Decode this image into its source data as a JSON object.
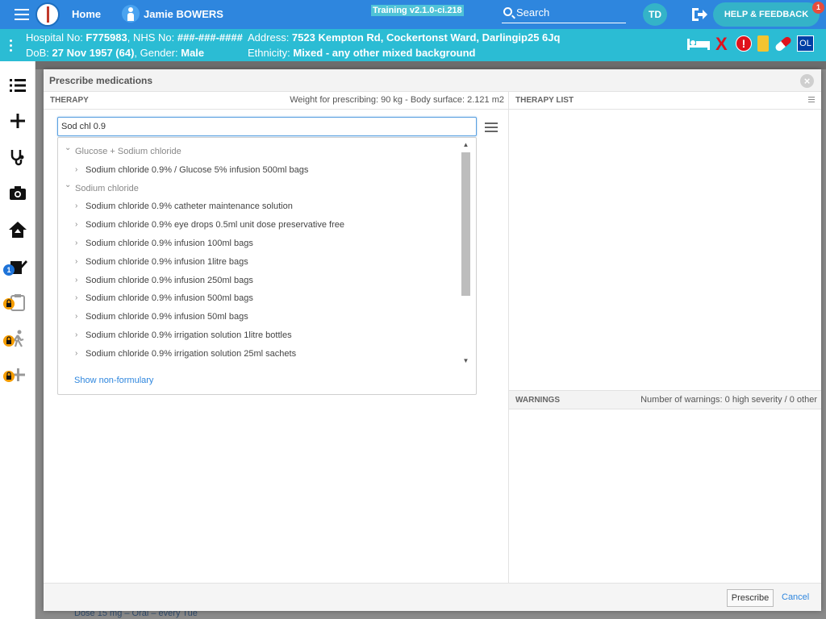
{
  "topbar": {
    "home_label": "Home",
    "patient_name": "Jamie BOWERS",
    "version": "Training v2.1.0-ci.218",
    "search_label": "Search",
    "user_initials": "TD",
    "help_label": "HELP & FEEDBACK",
    "help_badge": "1"
  },
  "banner": {
    "hospital_label": "Hospital No: ",
    "hospital_no": "F775983",
    "nhs_label": ", NHS No: ",
    "nhs_no": "###-###-####",
    "address_label": "Address: ",
    "address": "7523 Kempton Rd, Cockertonst Ward, Darlingip25 6Jq",
    "dob_label": "DoB: ",
    "dob": "27 Nov 1957 (64)",
    "gender_label": ", Gender: ",
    "gender": "Male",
    "ethnicity_label": "Ethnicity: ",
    "ethnicity": "Mixed - any other mixed background",
    "alert_excl": "!",
    "alert_x": "X",
    "alert_ol": "OL"
  },
  "sidebar": {
    "badge_tasks": "1"
  },
  "modal": {
    "title": "Prescribe medications",
    "therapy_label": "THERAPY",
    "weight_info": "Weight for prescribing: 90 kg - Body surface: 2.121 m2",
    "search_value": "Sod chl 0.9",
    "therapy_list_label": "THERAPY LIST",
    "warnings_label": "WARNINGS",
    "warnings_info": "Number of warnings: 0 high severity / 0 other",
    "show_non_formulary": "Show non-formulary",
    "prescribe_label": "Prescribe",
    "cancel_label": "Cancel",
    "results": [
      {
        "type": "group",
        "label": "Glucose + Sodium chloride"
      },
      {
        "type": "item",
        "label": "Sodium chloride 0.9% / Glucose 5% infusion 500ml bags"
      },
      {
        "type": "group",
        "label": "Sodium chloride"
      },
      {
        "type": "item",
        "label": "Sodium chloride 0.9% catheter maintenance solution"
      },
      {
        "type": "item",
        "label": "Sodium chloride 0.9% eye drops 0.5ml unit dose preservative free"
      },
      {
        "type": "item",
        "label": "Sodium chloride 0.9% infusion 100ml bags"
      },
      {
        "type": "item",
        "label": "Sodium chloride 0.9% infusion 1litre bags"
      },
      {
        "type": "item",
        "label": "Sodium chloride 0.9% infusion 250ml bags"
      },
      {
        "type": "item",
        "label": "Sodium chloride 0.9% infusion 500ml bags"
      },
      {
        "type": "item",
        "label": "Sodium chloride 0.9% infusion 50ml bags"
      },
      {
        "type": "item",
        "label": "Sodium chloride 0.9% irrigation solution 1litre bottles"
      },
      {
        "type": "item",
        "label": "Sodium chloride 0.9% irrigation solution 25ml sachets"
      }
    ]
  },
  "background": {
    "bottom_text": "Dose 15 mg – Oral – every Tue"
  }
}
